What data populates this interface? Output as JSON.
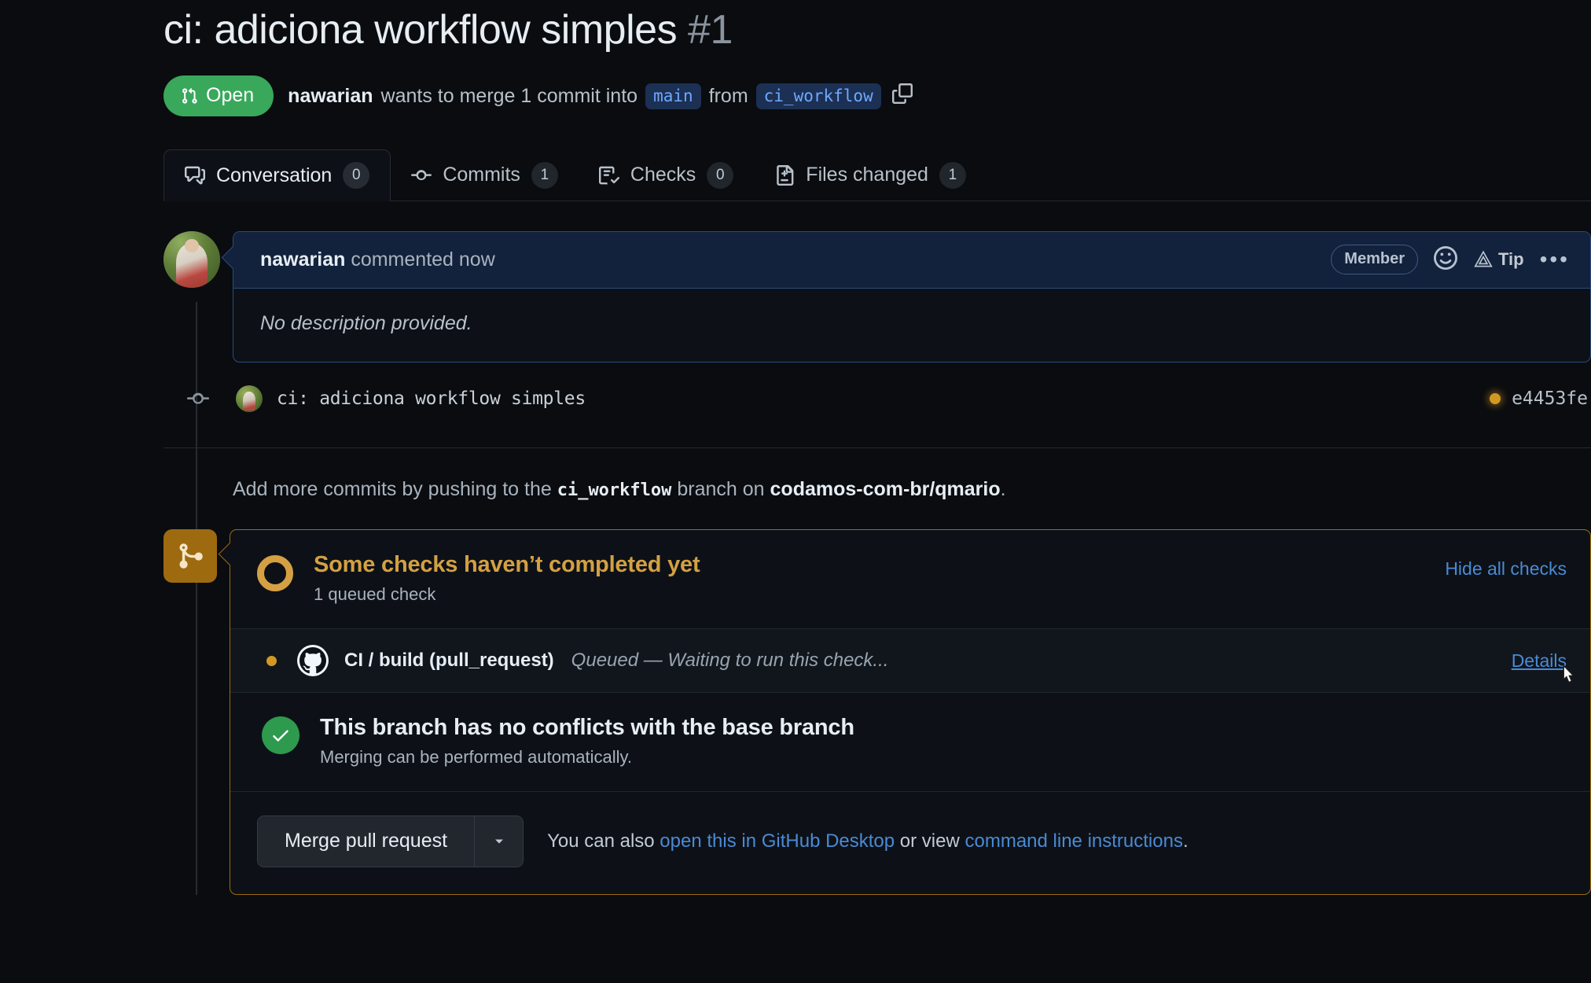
{
  "pr": {
    "title": "ci: adiciona workflow simples",
    "number": "#1",
    "state": "Open",
    "author": "nawarian",
    "status_prefix": "wants to merge 1 commit into",
    "base_branch": "main",
    "from_word": "from",
    "head_branch": "ci_workflow",
    "copy_icon": "copy-icon"
  },
  "tabs": [
    {
      "label": "Conversation",
      "count": "0",
      "icon": "comment-discussion-icon",
      "active": true
    },
    {
      "label": "Commits",
      "count": "1",
      "icon": "git-commit-icon",
      "active": false
    },
    {
      "label": "Checks",
      "count": "0",
      "icon": "checklist-icon",
      "active": false
    },
    {
      "label": "Files changed",
      "count": "1",
      "icon": "file-diff-icon",
      "active": false
    }
  ],
  "comment": {
    "author": "nawarian",
    "action": "commented now",
    "member_badge": "Member",
    "reaction_icon": "smiley-icon",
    "tip_label": "Tip",
    "tip_icon": "pyramid-tip-icon",
    "menu_icon": "kebab-menu-icon",
    "body": "No description provided."
  },
  "commit": {
    "message": "ci: adiciona workflow simples",
    "sha": "e4453fe",
    "status_color": "#d29922"
  },
  "push_note": {
    "before": "Add more commits by pushing to the",
    "branch": "ci_workflow",
    "middle": "branch on",
    "repo": "codamos-com-br/qmario",
    "after": "."
  },
  "merge_box": {
    "badge_icon": "git-merge-icon",
    "accent_color": "#9e6a10",
    "checks_title": "Some checks haven’t completed yet",
    "checks_subtitle": "1 queued check",
    "hide_all_checks": "Hide all checks",
    "check": {
      "name": "CI / build (pull_request)",
      "status": "Queued — Waiting to run this check...",
      "details_label": "Details",
      "provider_icon": "github-mark-icon",
      "dot_color": "#d29922"
    },
    "conflict": {
      "title": "This branch has no conflicts with the base branch",
      "subtitle": "Merging can be performed automatically.",
      "icon": "check-circle-icon",
      "color": "#2d9a4e"
    },
    "footer": {
      "merge_button": "Merge pull request",
      "caret_icon": "chevron-down-icon",
      "note_before": "You can also",
      "link_desktop": "open this in GitHub Desktop",
      "note_middle": "or view",
      "link_cli": "command line instructions",
      "note_after": "."
    }
  }
}
